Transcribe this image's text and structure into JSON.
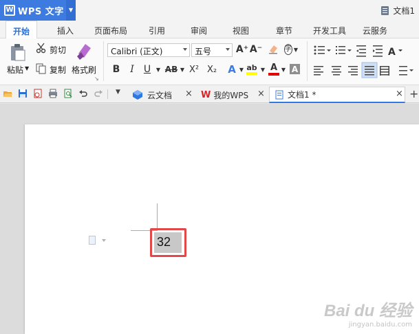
{
  "app": {
    "name": "WPS 文字",
    "logo": "W",
    "doc_title": "文档1"
  },
  "menu": {
    "tabs": [
      "开始",
      "插入",
      "页面布局",
      "引用",
      "审阅",
      "视图",
      "章节",
      "开发工具",
      "云服务"
    ]
  },
  "ribbon": {
    "paste": "粘贴",
    "cut": "剪切",
    "copy": "复制",
    "format_painter": "格式刷",
    "font": "Calibri (正文)",
    "size": "五号",
    "bold": "B",
    "italic": "I",
    "underline": "U",
    "strike": "AB",
    "superscript": "X²",
    "subscript": "X₂",
    "grow": "A⁺",
    "shrink": "A⁻",
    "clear": "A",
    "phonetic": "字",
    "highlight": "ab",
    "fontcolor": "A",
    "charshade": "A",
    "text_effect": "A",
    "colors": {
      "accent": "#2a6fd6",
      "highlight": "#ffff00",
      "fontcolor": "#ff0000",
      "brand": "#3d7be0"
    }
  },
  "tabsbar": {
    "docs": [
      {
        "label": "云文档",
        "icon": "cloud-icon"
      },
      {
        "label": "我的WPS",
        "icon": "wps-logo-icon"
      },
      {
        "label": "文档1 *",
        "icon": "document-icon"
      }
    ],
    "close": "×",
    "add": "+"
  },
  "document": {
    "selected_text": "32"
  },
  "watermark": {
    "main": "Bai du 经验",
    "sub": "jingyan.baidu.com"
  }
}
